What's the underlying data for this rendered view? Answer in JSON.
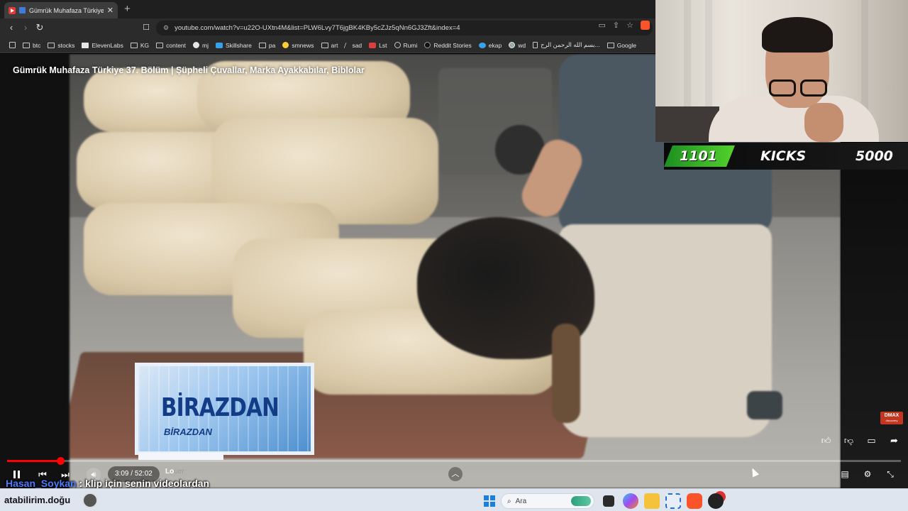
{
  "browser": {
    "tab_title": "Gümrük Muhafaza Türkiye 37",
    "tab_close": "✕",
    "new_tab": "+",
    "url": "youtube.com/watch?v=u22O-UXtn4M&list=PLW6Lvy7T6jgBK4KBy5cZJz5qNn6GJ3Zft&index=4",
    "bookmarks": [
      {
        "label": "btc",
        "icon": "folder-icon"
      },
      {
        "label": "stocks",
        "icon": "folder-icon"
      },
      {
        "label": "ElevenLabs",
        "icon": "elevenlabs-icon"
      },
      {
        "label": "KG",
        "icon": "folder-icon"
      },
      {
        "label": "content",
        "icon": "folder-icon"
      },
      {
        "label": "mj",
        "icon": "github-icon"
      },
      {
        "label": "Skillshare",
        "icon": "skillshare-icon"
      },
      {
        "label": "pa",
        "icon": "folder-icon"
      },
      {
        "label": "smnews",
        "icon": "smiley-icon"
      },
      {
        "label": "art",
        "icon": "folder-icon"
      },
      {
        "label": "sad",
        "icon": "slash-icon"
      },
      {
        "label": "Lst",
        "icon": "s-icon"
      },
      {
        "label": "Rumi",
        "icon": "globe-icon"
      },
      {
        "label": "Reddit Stories",
        "icon": "d-icon"
      },
      {
        "label": "ekap",
        "icon": "bird-icon"
      },
      {
        "label": "wd",
        "icon": "wd-icon"
      },
      {
        "label": "بسم الله الرحمن الرح...",
        "icon": "doc-icon"
      },
      {
        "label": "Google",
        "icon": "folder-icon"
      }
    ]
  },
  "video": {
    "title": "Gümrük Muhafaza Türkiye 37. Bölüm | Şüpheli Çuvallar, Marka Ayakkabılar, Biblolar",
    "overlay_big": "BİRAZDAN",
    "overlay_small": "BİRAZDAN",
    "channel_logo": "DMAX",
    "current_time": "3:09",
    "duration": "52:02",
    "time_sep": " / ",
    "progress_fraction": 0.0594,
    "chapter_prefix": "Lo",
    "chapter_faded": "uer"
  },
  "chat": {
    "user": "Hasan_Soykan",
    "message": ": klip için senin videolardan"
  },
  "kicks": {
    "count": "1101",
    "label": "KICKS",
    "goal": "5000"
  },
  "taskbar": {
    "left_text": "atabilirim.doğu",
    "search_placeholder": "Ara"
  },
  "colors": {
    "progress": "#ff0000",
    "kicks_green": "#53d22c",
    "chat_user": "#4b7bff"
  }
}
